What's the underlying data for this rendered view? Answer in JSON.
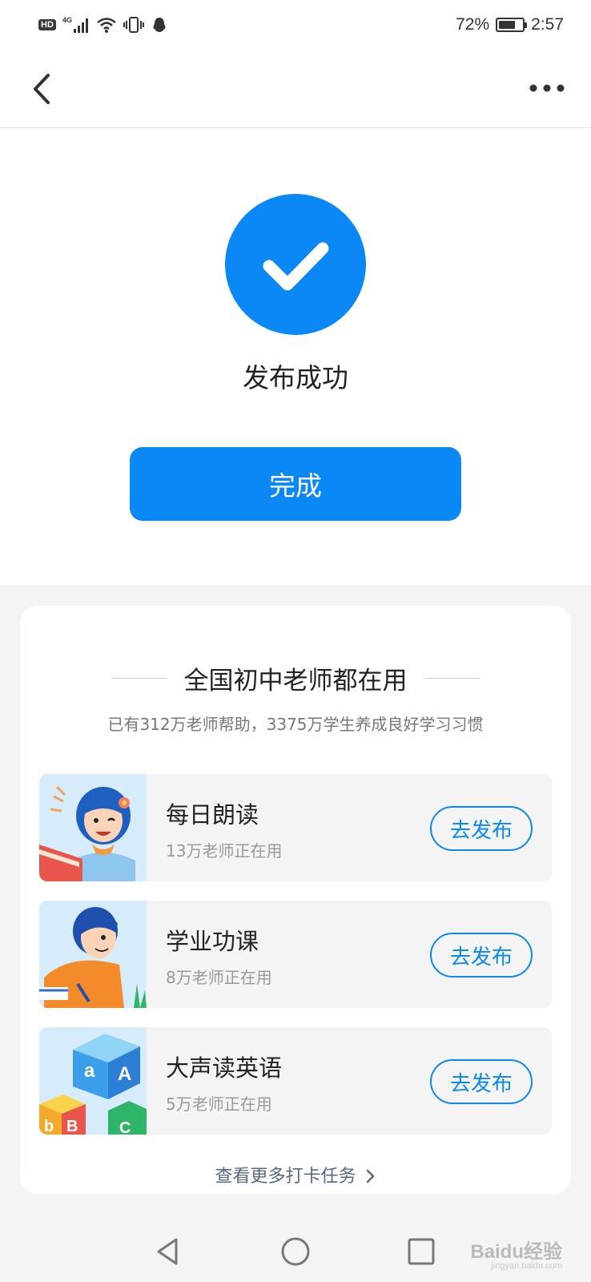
{
  "status_bar": {
    "hd": "HD",
    "network": "4G",
    "battery_percent": "72%",
    "battery_level": 0.72,
    "time": "2:57"
  },
  "nav": {
    "back_icon": "chevron-left-icon",
    "more_icon": "more-horizontal-icon"
  },
  "success": {
    "icon": "check-icon",
    "accent_color": "#0a88f5",
    "message": "发布成功",
    "done_label": "完成"
  },
  "promo": {
    "title": "全国初中老师都在用",
    "subtitle": "已有312万老师帮助，3375万学生养成良好学习习惯",
    "tasks": [
      {
        "name": "每日朗读",
        "users": "13万老师正在用",
        "button": "去发布"
      },
      {
        "name": "学业功课",
        "users": "8万老师正在用",
        "button": "去发布"
      },
      {
        "name": "大声读英语",
        "users": "5万老师正在用",
        "button": "去发布"
      }
    ],
    "more_link": "查看更多打卡任务"
  },
  "watermark": {
    "text": "Baidu经验",
    "url_text": "jingyan.baidu.com"
  }
}
